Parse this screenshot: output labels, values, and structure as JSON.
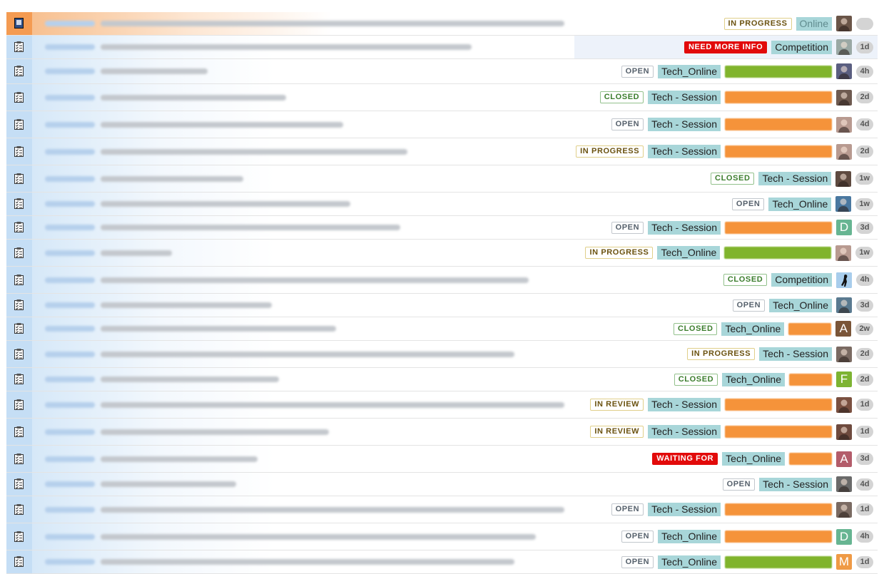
{
  "rows": [
    {
      "status": "IN PROGRESS",
      "st": "inprogress",
      "component": "Online",
      "component_dim": true,
      "label": "",
      "label_color": "",
      "avatar": "photo",
      "avatar_letter": "",
      "avatar_color": "#6a5548",
      "age": "",
      "summary_len": 760,
      "row_h": 32
    },
    {
      "status": "NEED MORE INFO",
      "st": "needmoreinfo",
      "component": "Competition",
      "label": "",
      "label_color": "",
      "avatar": "photo",
      "avatar_letter": "",
      "avatar_color": "#9aa8a4",
      "age": "1d",
      "summary_len": 520,
      "row_h": 32,
      "selected": true
    },
    {
      "status": "OPEN",
      "st": "open",
      "component": "Tech_Online",
      "label": "",
      "label_color": "#80b42c",
      "avatar": "photo",
      "avatar_letter": "",
      "avatar_color": "#5a5e80",
      "age": "4h",
      "summary_len": 150,
      "row_h": 34
    },
    {
      "status": "CLOSED",
      "st": "closed",
      "component": "Tech - Session",
      "label": "",
      "label_color": "#f5933a",
      "avatar": "photo",
      "avatar_letter": "",
      "avatar_color": "#6e5a50",
      "age": "2d",
      "summary_len": 260,
      "row_h": 37
    },
    {
      "status": "OPEN",
      "st": "open",
      "component": "Tech - Session",
      "label": "",
      "label_color": "#f5933a",
      "avatar": "photo",
      "avatar_letter": "",
      "avatar_color": "#b89a90",
      "age": "4d",
      "summary_len": 340,
      "row_h": 37
    },
    {
      "status": "IN PROGRESS",
      "st": "inprogress",
      "component": "Tech - Session",
      "label": "",
      "label_color": "#f5933a",
      "avatar": "photo",
      "avatar_letter": "",
      "avatar_color": "#b89a90",
      "age": "2d",
      "summary_len": 430,
      "row_h": 37
    },
    {
      "status": "CLOSED",
      "st": "closed",
      "component": "Tech - Session",
      "label": "",
      "label_color": "",
      "avatar": "photo",
      "avatar_letter": "",
      "avatar_color": "#5e4a40",
      "age": "1w",
      "summary_len": 200,
      "row_h": 37
    },
    {
      "status": "OPEN",
      "st": "open",
      "component": "Tech_Online",
      "label": "",
      "label_color": "",
      "avatar": "photo",
      "avatar_letter": "",
      "avatar_color": "#4a78a0",
      "age": "1w",
      "summary_len": 350,
      "row_h": 32
    },
    {
      "status": "OPEN",
      "st": "open",
      "component": "Tech - Session",
      "label": "",
      "label_color": "#f5933a",
      "avatar": "letter",
      "avatar_letter": "D",
      "avatar_color": "#67b592",
      "age": "3d",
      "summary_len": 420,
      "row_h": 32
    },
    {
      "status": "IN PROGRESS",
      "st": "inprogress",
      "component": "Tech_Online",
      "label": "",
      "label_color": "#80b42c",
      "avatar": "photo",
      "avatar_letter": "",
      "avatar_color": "#b89a90",
      "age": "1w",
      "summary_len": 100,
      "row_h": 37
    },
    {
      "status": "CLOSED",
      "st": "closed",
      "component": "Competition",
      "label": "",
      "label_color": "",
      "avatar": "silhouette",
      "avatar_letter": "",
      "avatar_color": "#6aa0d0",
      "age": "4h",
      "summary_len": 600,
      "row_h": 37
    },
    {
      "status": "OPEN",
      "st": "open",
      "component": "Tech_Online",
      "label": "",
      "label_color": "",
      "avatar": "photo",
      "avatar_letter": "",
      "avatar_color": "#5a7a90",
      "age": "3d",
      "summary_len": 240,
      "row_h": 32
    },
    {
      "status": "CLOSED",
      "st": "closed",
      "component": "Tech_Online",
      "label": "",
      "label_color": "#f5933a",
      "label_small": true,
      "avatar": "letter",
      "avatar_letter": "A",
      "avatar_color": "#7a5538",
      "age": "2w",
      "summary_len": 330,
      "row_h": 32
    },
    {
      "status": "IN PROGRESS",
      "st": "inprogress",
      "component": "Tech - Session",
      "label": "",
      "label_color": "",
      "avatar": "photo",
      "avatar_letter": "",
      "avatar_color": "#7a6a62",
      "age": "2d",
      "summary_len": 580,
      "row_h": 37
    },
    {
      "status": "CLOSED",
      "st": "closed",
      "component": "Tech_Online",
      "label": "",
      "label_color": "#f5933a",
      "label_small": true,
      "avatar": "letter",
      "avatar_letter": "F",
      "avatar_color": "#7db332",
      "age": "2d",
      "summary_len": 250,
      "row_h": 32
    },
    {
      "status": "IN REVIEW",
      "st": "inreview",
      "component": "Tech - Session",
      "label": "",
      "label_color": "#f5933a",
      "label_small": false,
      "avatar": "photo",
      "avatar_letter": "",
      "avatar_color": "#7a5040",
      "age": "1d",
      "summary_len": 700,
      "row_h": 37
    },
    {
      "status": "IN REVIEW",
      "st": "inreview",
      "component": "Tech - Session",
      "label": "",
      "label_color": "#f5933a",
      "avatar": "photo",
      "avatar_letter": "",
      "avatar_color": "#6e4a3e",
      "age": "1d",
      "summary_len": 320,
      "row_h": 37
    },
    {
      "status": "WAITING FOR",
      "st": "waitingfor",
      "component": "Tech_Online",
      "label": "",
      "label_color": "#f5933a",
      "label_small": true,
      "avatar": "letter",
      "avatar_letter": "A",
      "avatar_color": "#b35c6a",
      "age": "3d",
      "summary_len": 220,
      "row_h": 37
    },
    {
      "status": "OPEN",
      "st": "open",
      "component": "Tech - Session",
      "label": "",
      "label_color": "",
      "avatar": "photo",
      "avatar_letter": "",
      "avatar_color": "#6a6a6a",
      "age": "4d",
      "summary_len": 190,
      "row_h": 32
    },
    {
      "status": "OPEN",
      "st": "open",
      "component": "Tech - Session",
      "label": "",
      "label_color": "#f5933a",
      "avatar": "photo",
      "avatar_letter": "",
      "avatar_color": "#7a6a62",
      "age": "1d",
      "summary_len": 720,
      "row_h": 37
    },
    {
      "status": "OPEN",
      "st": "open",
      "component": "Tech_Online",
      "label": "",
      "label_color": "#f5933a",
      "avatar": "letter",
      "avatar_letter": "D",
      "avatar_color": "#67b592",
      "age": "4h",
      "summary_len": 610,
      "row_h": 37
    },
    {
      "status": "OPEN",
      "st": "open",
      "component": "Tech_Online",
      "label": "",
      "label_color": "#80b42c",
      "avatar": "letter",
      "avatar_letter": "M",
      "avatar_color": "#ef9a45",
      "age": "1d",
      "summary_len": 580,
      "row_h": 32
    }
  ]
}
